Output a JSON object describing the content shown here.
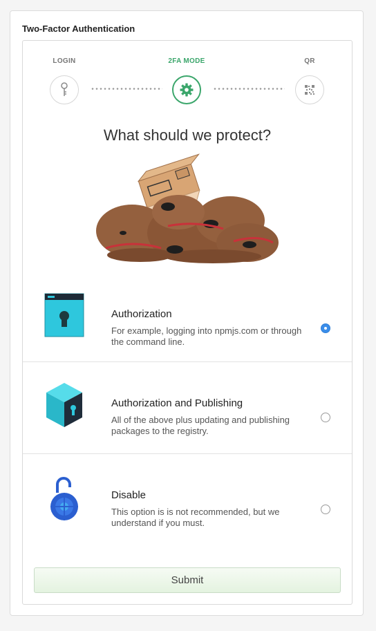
{
  "panel": {
    "title": "Two-Factor Authentication"
  },
  "stepper": {
    "steps": [
      {
        "label": "LOGIN",
        "icon": "key-icon",
        "active": false
      },
      {
        "label": "2FA MODE",
        "icon": "gear-icon",
        "active": true
      },
      {
        "label": "QR",
        "icon": "qr-code-icon",
        "active": false
      }
    ]
  },
  "heading": "What should we protect?",
  "options": [
    {
      "title": "Authorization",
      "description": "For example, logging into npmjs.com or through the command line.",
      "icon": "browser-lock-icon",
      "selected": true
    },
    {
      "title": "Authorization and Publishing",
      "description": "All of the above plus updating and publishing packages to the registry.",
      "icon": "package-lock-icon",
      "selected": false
    },
    {
      "title": "Disable",
      "description": "This option is is not recommended, but we understand if you must.",
      "icon": "open-padlock-icon",
      "selected": false
    }
  ],
  "submit_label": "Submit",
  "colors": {
    "accent_green": "#3ba66b",
    "radio_blue": "#3b8eea"
  }
}
